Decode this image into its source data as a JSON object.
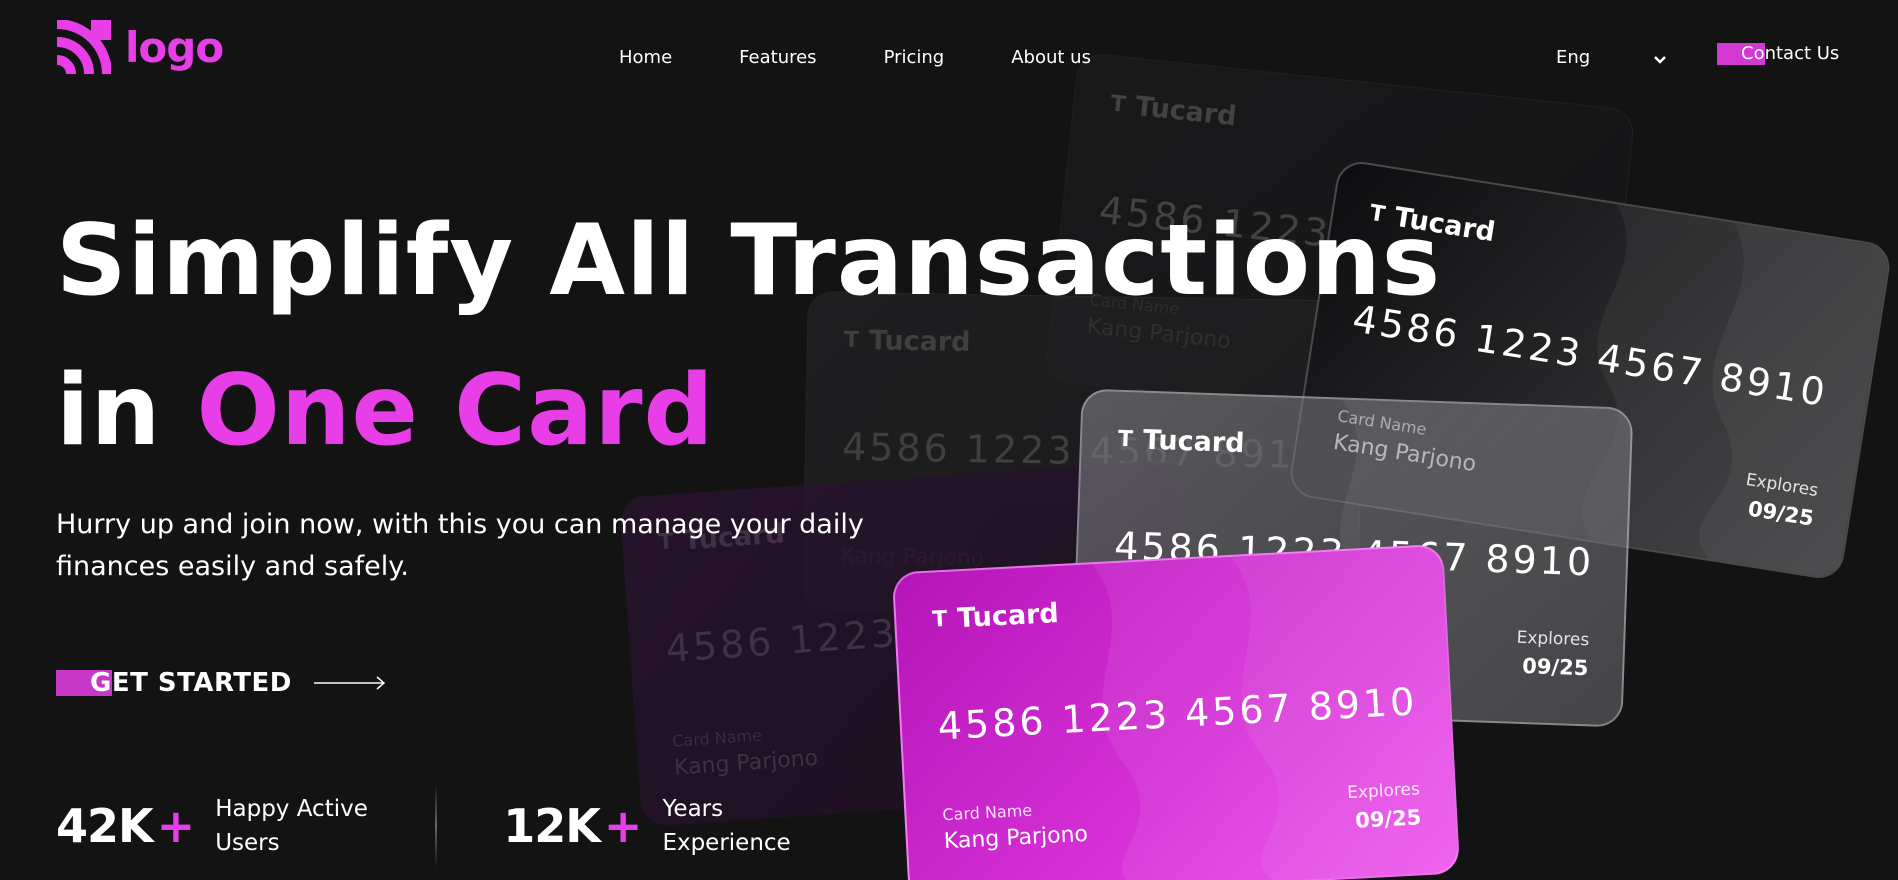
{
  "header": {
    "logo_text": "logo",
    "nav": [
      "Home",
      "Features",
      "Pricing",
      "About us"
    ],
    "language": "Eng",
    "contact_label": "Contact Us"
  },
  "hero": {
    "title_line1": "Simplify All Transactions",
    "title_line2_plain": "in ",
    "title_line2_accent": "One Card",
    "subtitle": "Hurry up and join now, with this you can manage your daily finances easily and safely.",
    "cta_label": "GET STARTED"
  },
  "stats": [
    {
      "value": "42K",
      "plus": "+",
      "label": "Happy Active Users"
    },
    {
      "value": "12K",
      "plus": "+",
      "label": "Years Experience"
    }
  ],
  "card": {
    "brand": "Tucard",
    "number": "4586 1223 4567 8910",
    "name_label": "Card Name",
    "name": "Kang Parjono",
    "expiry_label": "Explores",
    "expiry": "09/25"
  },
  "colors": {
    "accent": "#e83ee8",
    "background": "#131314"
  },
  "icons": {
    "logo": "wifi-arc-logo-icon",
    "language_toggle": "chevron-down-icon",
    "cta": "arrow-right-icon",
    "card_brand": "tucard-t-icon"
  }
}
